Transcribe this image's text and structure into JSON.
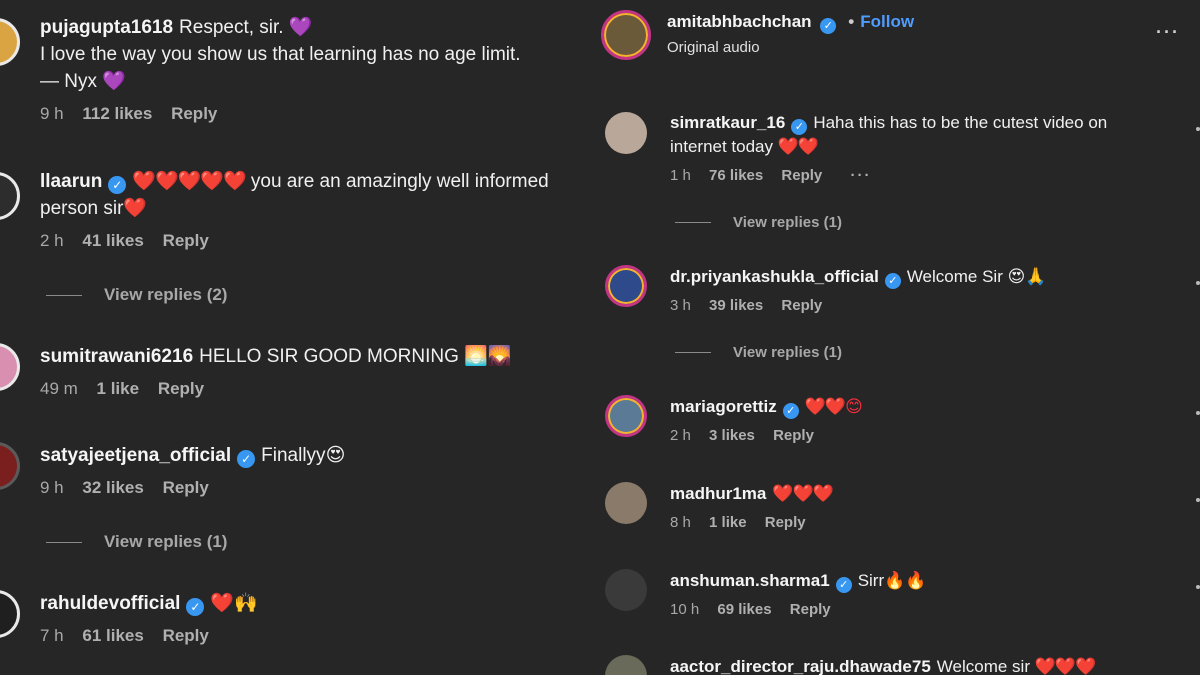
{
  "left_comments": [
    {
      "user": "pujagupta1618",
      "verified": false,
      "text": "Respect, sir. ",
      "emoji": "💜",
      "line2": "I love the way you show us that learning has no age limit.",
      "line3": "— Nyx ",
      "emoji3": "💜",
      "time": "9 h",
      "likes": "112 likes",
      "reply": "Reply"
    },
    {
      "user": "llaarun",
      "verified": true,
      "hearts": "❤️❤️❤️❤️❤️",
      "text": " you are an amazingly well informed",
      "line2": "person sir",
      "emoji2": "❤️",
      "time": "2 h",
      "likes": "41 likes",
      "reply": "Reply",
      "view_replies": "View replies (2)"
    },
    {
      "user": "sumitrawani6216",
      "verified": false,
      "text": "HELLO SIR GOOD MORNING ",
      "emoji": "🌅🌄",
      "time": "49 m",
      "likes": "1 like",
      "reply": "Reply"
    },
    {
      "user": "satyajeetjena_official",
      "verified": true,
      "text": "Finallyy",
      "emoji": "😍",
      "time": "9 h",
      "likes": "32 likes",
      "reply": "Reply",
      "view_replies": "View replies (1)"
    },
    {
      "user": "rahuldevofficial",
      "verified": true,
      "emoji": "❤️🙌",
      "time": "7 h",
      "likes": "61 likes",
      "reply": "Reply"
    }
  ],
  "post": {
    "author": "amitabhbachchan",
    "separator": "•",
    "follow": "Follow",
    "audio": "Original audio",
    "more": "···"
  },
  "right_comments": [
    {
      "user": "simratkaur_16",
      "verified": true,
      "text": "Haha this has to be the cutest video on",
      "line2": "internet today ",
      "emoji2": "❤️❤️",
      "time": "1 h",
      "likes": "76 likes",
      "reply": "Reply",
      "more": "···",
      "view_replies": "View replies (1)"
    },
    {
      "user": "dr.priyankashukla_official",
      "verified": true,
      "text": "Welcome Sir ",
      "emoji": "😍🙏",
      "time": "3 h",
      "likes": "39 likes",
      "reply": "Reply",
      "view_replies": "View replies (1)"
    },
    {
      "user": "mariagorettiz",
      "verified": true,
      "emoji": "❤️❤️😊",
      "time": "2 h",
      "likes": "3 likes",
      "reply": "Reply"
    },
    {
      "user": "madhur1ma",
      "verified": false,
      "emoji": "❤️❤️❤️",
      "time": "8 h",
      "likes": "1 like",
      "reply": "Reply"
    },
    {
      "user": "anshuman.sharma1",
      "verified": true,
      "text": "Sirr",
      "emoji": "🔥🔥",
      "time": "10 h",
      "likes": "69 likes",
      "reply": "Reply"
    },
    {
      "user": "aactor_director_raju.dhawade75",
      "verified": false,
      "text": "Welcome sir ",
      "emoji": "❤️❤️❤️"
    }
  ],
  "colors": {
    "background": "#262626",
    "link": "#4f9cff",
    "verified": "#3897f0",
    "heart": "#ff2d3f"
  },
  "icons": {
    "verified": "verified-badge-icon",
    "more": "more-options-icon"
  }
}
